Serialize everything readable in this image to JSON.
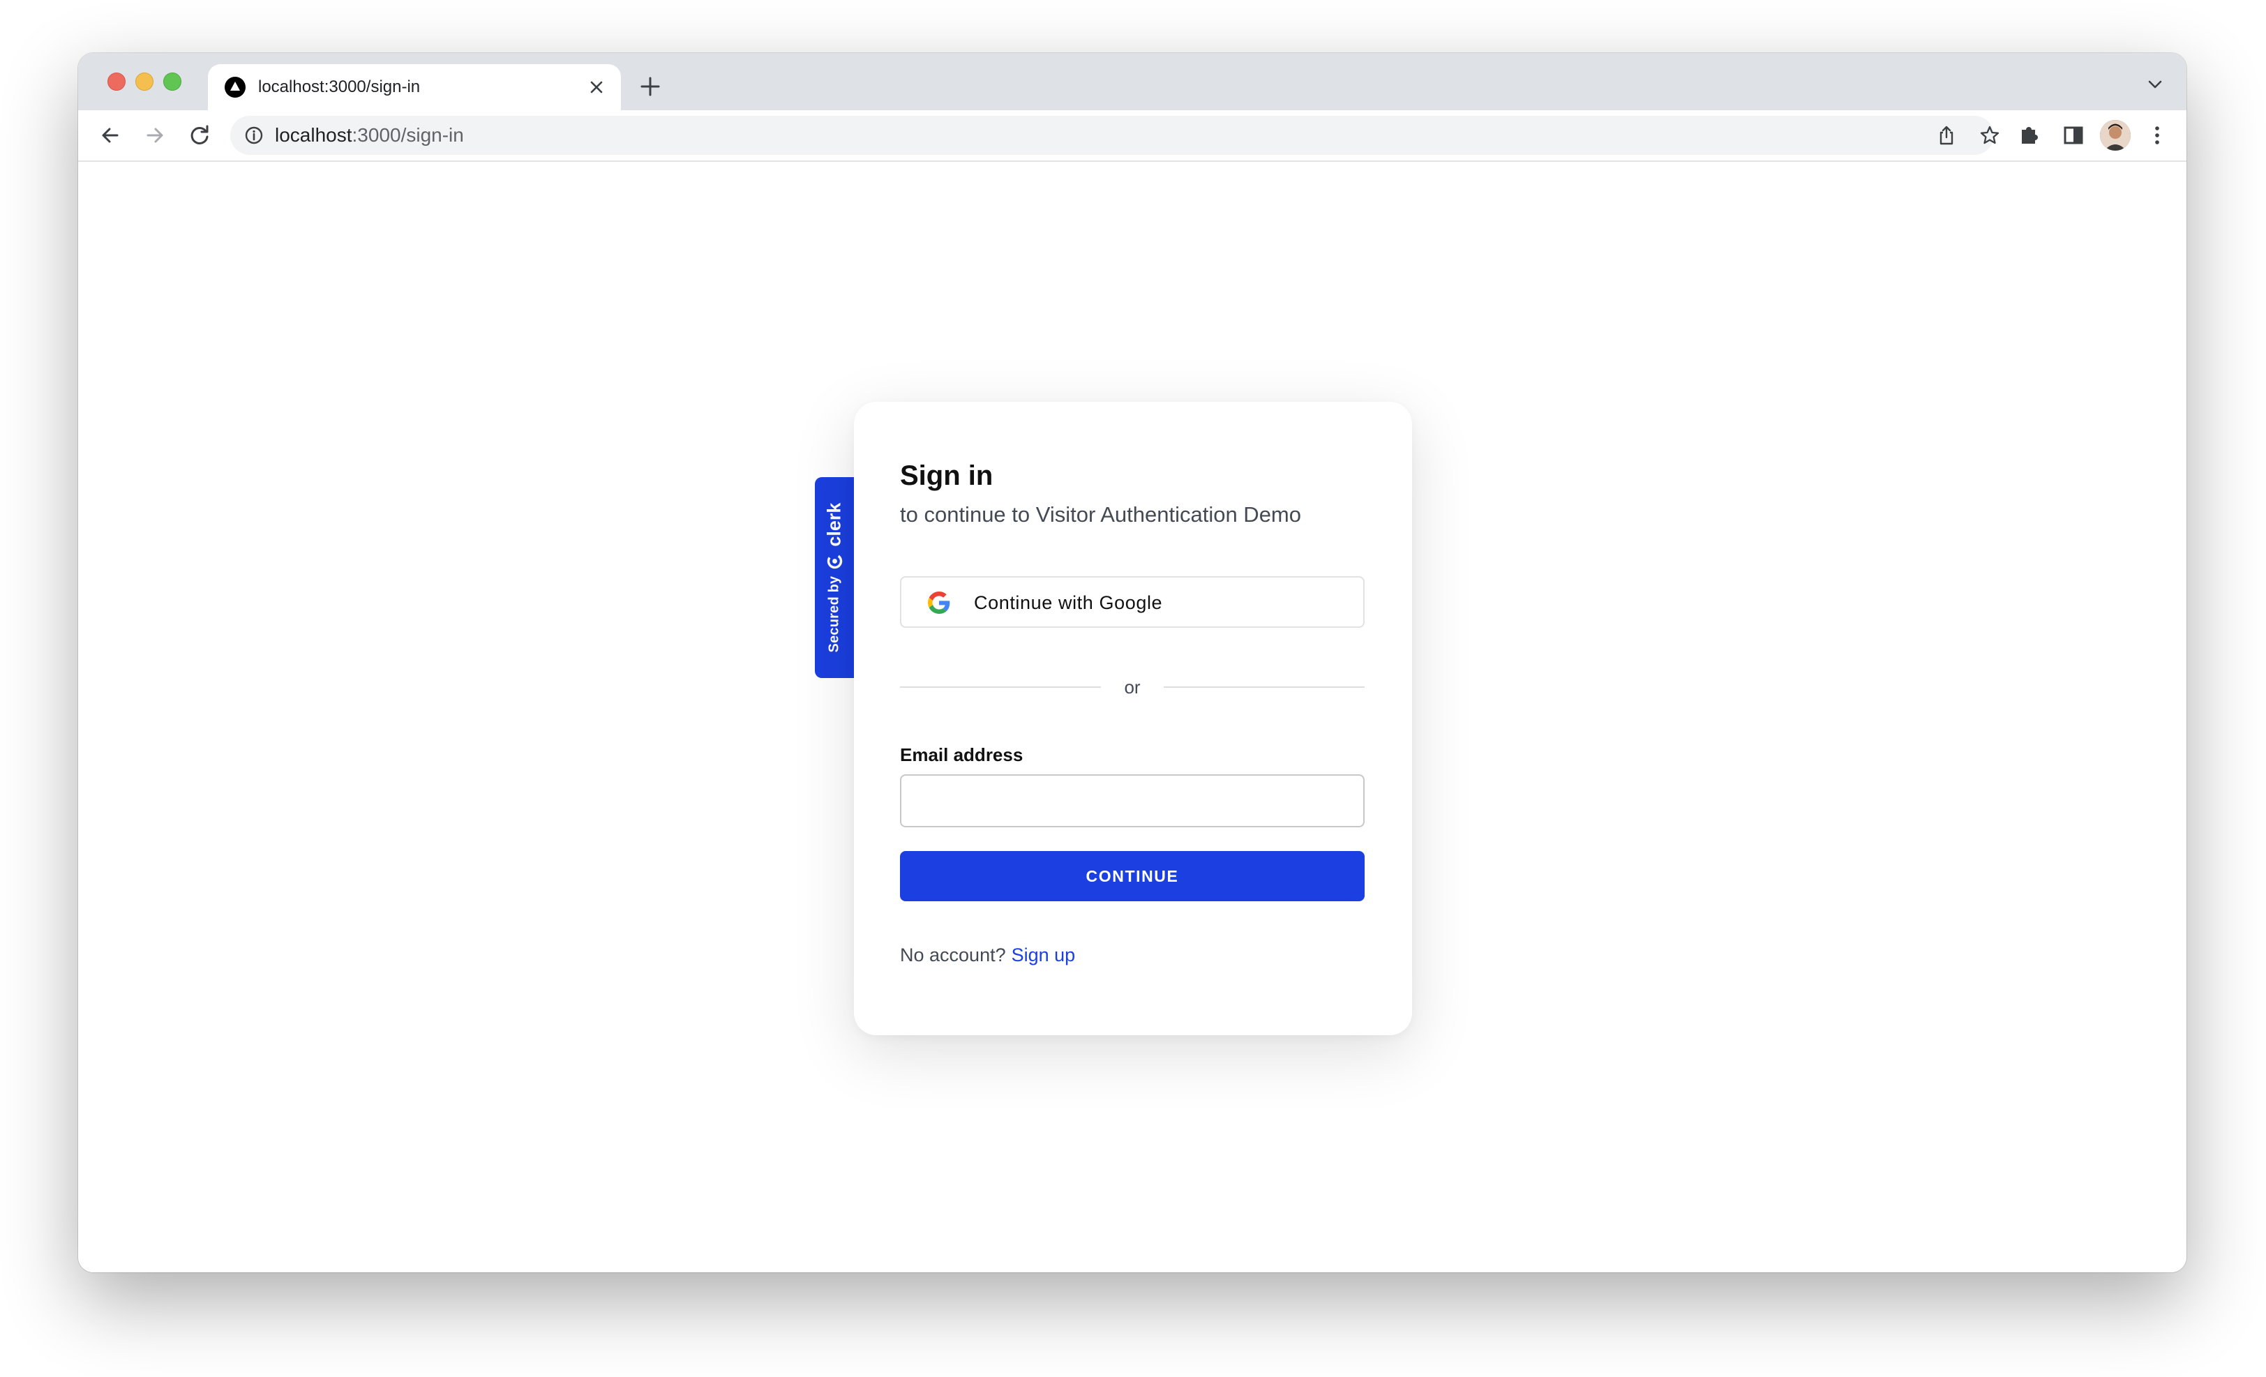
{
  "browser": {
    "tab": {
      "title": "localhost:3000/sign-in",
      "close_icon": "close-icon",
      "favicon": "vercel-triangle-icon"
    },
    "new_tab_icon": "plus-icon",
    "tab_search_icon": "chevron-down-icon",
    "address_bar": {
      "host": "localhost",
      "path": ":3000/sign-in",
      "info_icon": "info-icon"
    },
    "toolbar_icons": [
      "back-arrow-icon",
      "forward-arrow-icon",
      "reload-icon",
      "share-icon",
      "star-icon",
      "puzzle-icon",
      "side-panel-icon",
      "avatar",
      "kebab-menu-icon"
    ],
    "traffic_light_colors": {
      "close": "#ed6a5e",
      "minimize": "#f5bf4f",
      "maximize": "#61c554"
    }
  },
  "badge": {
    "secured_by": "Secured by",
    "brand": "clerk",
    "color": "#1b3fe0"
  },
  "signin": {
    "title": "Sign in",
    "subtitle": "to continue to Visitor Authentication Demo",
    "google_button": "Continue with Google",
    "divider": "or",
    "email_label": "Email address",
    "email_value": "",
    "continue_button": "CONTINUE",
    "no_account": "No account?",
    "sign_up": "Sign up",
    "accent_color": "#1b3fe0"
  }
}
